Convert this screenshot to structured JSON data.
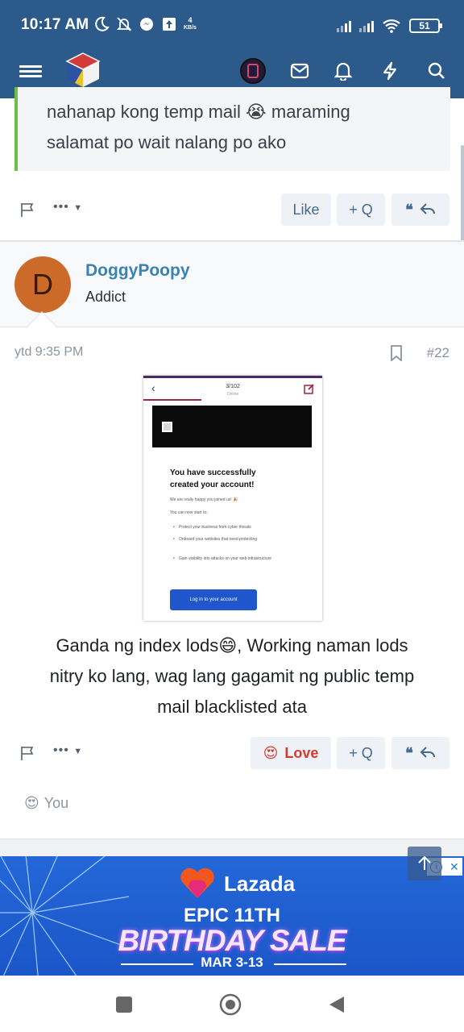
{
  "status_bar": {
    "time": "10:17 AM",
    "net_speed_value": "4",
    "net_speed_unit": "KB/s",
    "battery": "51"
  },
  "header": {
    "icons": [
      "menu-icon",
      "site-logo",
      "user-avatar",
      "inbox-icon",
      "bell-icon",
      "lightning-icon",
      "search-icon"
    ]
  },
  "quote": {
    "text_line1": "nahanap kong temp mail 😭 maraming",
    "text_line2": "salamat po wait nalang po ako"
  },
  "first_post_actions": {
    "more": "•••",
    "like": "Like",
    "quote": "+ Q",
    "reply_icons": "66 ↩"
  },
  "user": {
    "initial": "D",
    "name": "DoggyPoopy",
    "title": "Addict"
  },
  "post": {
    "date": "ytd 9:35 PM",
    "number": "#22",
    "body_line1": "Ganda ng index lods😄, Working naman lods",
    "body_line2": "nitry ko lang, wag lang gagamit ng public temp",
    "body_line3": "mail blacklisted ata"
  },
  "embedded_screenshot": {
    "counter": "3/102",
    "sub": "Online",
    "heading_line1": "You have successfully",
    "heading_line2": "created your account!",
    "line_happy": "We are really happy you joined us! 🎉",
    "line_start": "You can now start to:",
    "bullet1": "Protect your business from cyber threats",
    "bullet2": "Onboard your websites that need protecting",
    "bullet3": "Gain visibility into attacks on your web infrastructure",
    "button": "Log in to your account"
  },
  "second_post_actions": {
    "more": "•••",
    "love_emoji": "😍",
    "love": "Love",
    "quote": "+ Q"
  },
  "reactions": {
    "emoji": "😍",
    "who": "You"
  },
  "ad": {
    "brand": "Lazada",
    "line1": "EPIC 11TH",
    "line2": "BIRTHDAY SALE",
    "line3": "MAR 3-13"
  },
  "colors": {
    "header_bg": "#2c5a8a",
    "accent_link": "#3a82b2",
    "love_red": "#d23a2f",
    "quote_border": "#6ac043"
  }
}
